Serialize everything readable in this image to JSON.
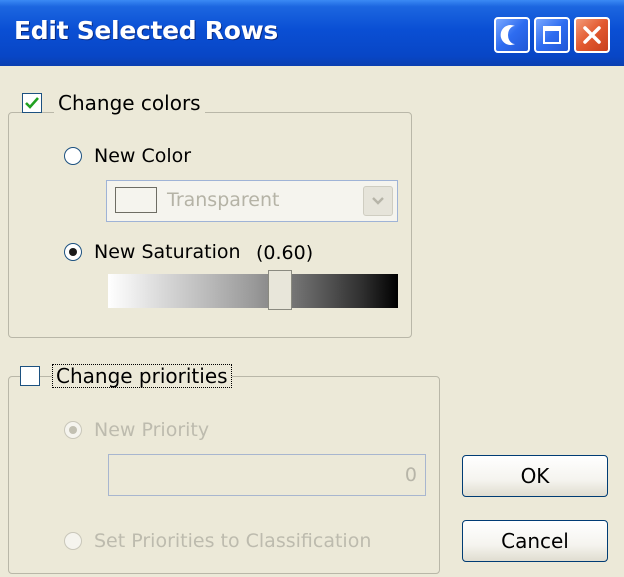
{
  "window": {
    "title": "Edit Selected Rows",
    "controls": [
      "minimize-icon",
      "maximize-icon",
      "close-icon"
    ]
  },
  "change_colors": {
    "label": "Change colors",
    "checked": true,
    "new_color": {
      "label": "New Color",
      "selected": false,
      "dropdown_value": "Transparent"
    },
    "new_saturation": {
      "label": "New Saturation",
      "value_text": "(0.60)",
      "selected": true,
      "value": 0.6
    }
  },
  "change_priorities": {
    "label": "Change priorities",
    "checked": false,
    "new_priority": {
      "label": "New Priority",
      "selected": true,
      "value": "0"
    },
    "set_to_classification": {
      "label": "Set Priorities to Classification",
      "selected": false
    }
  },
  "buttons": {
    "ok": "OK",
    "cancel": "Cancel"
  },
  "colors": {
    "titlebar": "#0a4fd4",
    "dialog_bg": "#ece9d8",
    "check": "#21a121",
    "close_button": "#e2592f"
  }
}
